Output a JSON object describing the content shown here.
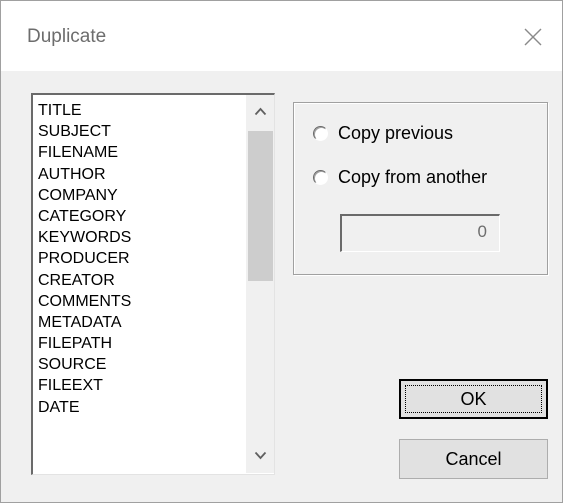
{
  "window": {
    "title": "Duplicate",
    "close_icon": "close-icon"
  },
  "fields_list": {
    "items": [
      "TITLE",
      "SUBJECT",
      "FILENAME",
      "AUTHOR",
      "COMPANY",
      "CATEGORY",
      "KEYWORDS",
      "PRODUCER",
      "CREATOR",
      "COMMENTS",
      "METADATA",
      "FILEPATH",
      "SOURCE",
      "FILEEXT",
      "DATE"
    ]
  },
  "options": {
    "copy_previous_label": "Copy previous",
    "copy_from_another_label": "Copy from another",
    "copy_from_another_value": "0"
  },
  "buttons": {
    "ok_label": "OK",
    "cancel_label": "Cancel"
  }
}
